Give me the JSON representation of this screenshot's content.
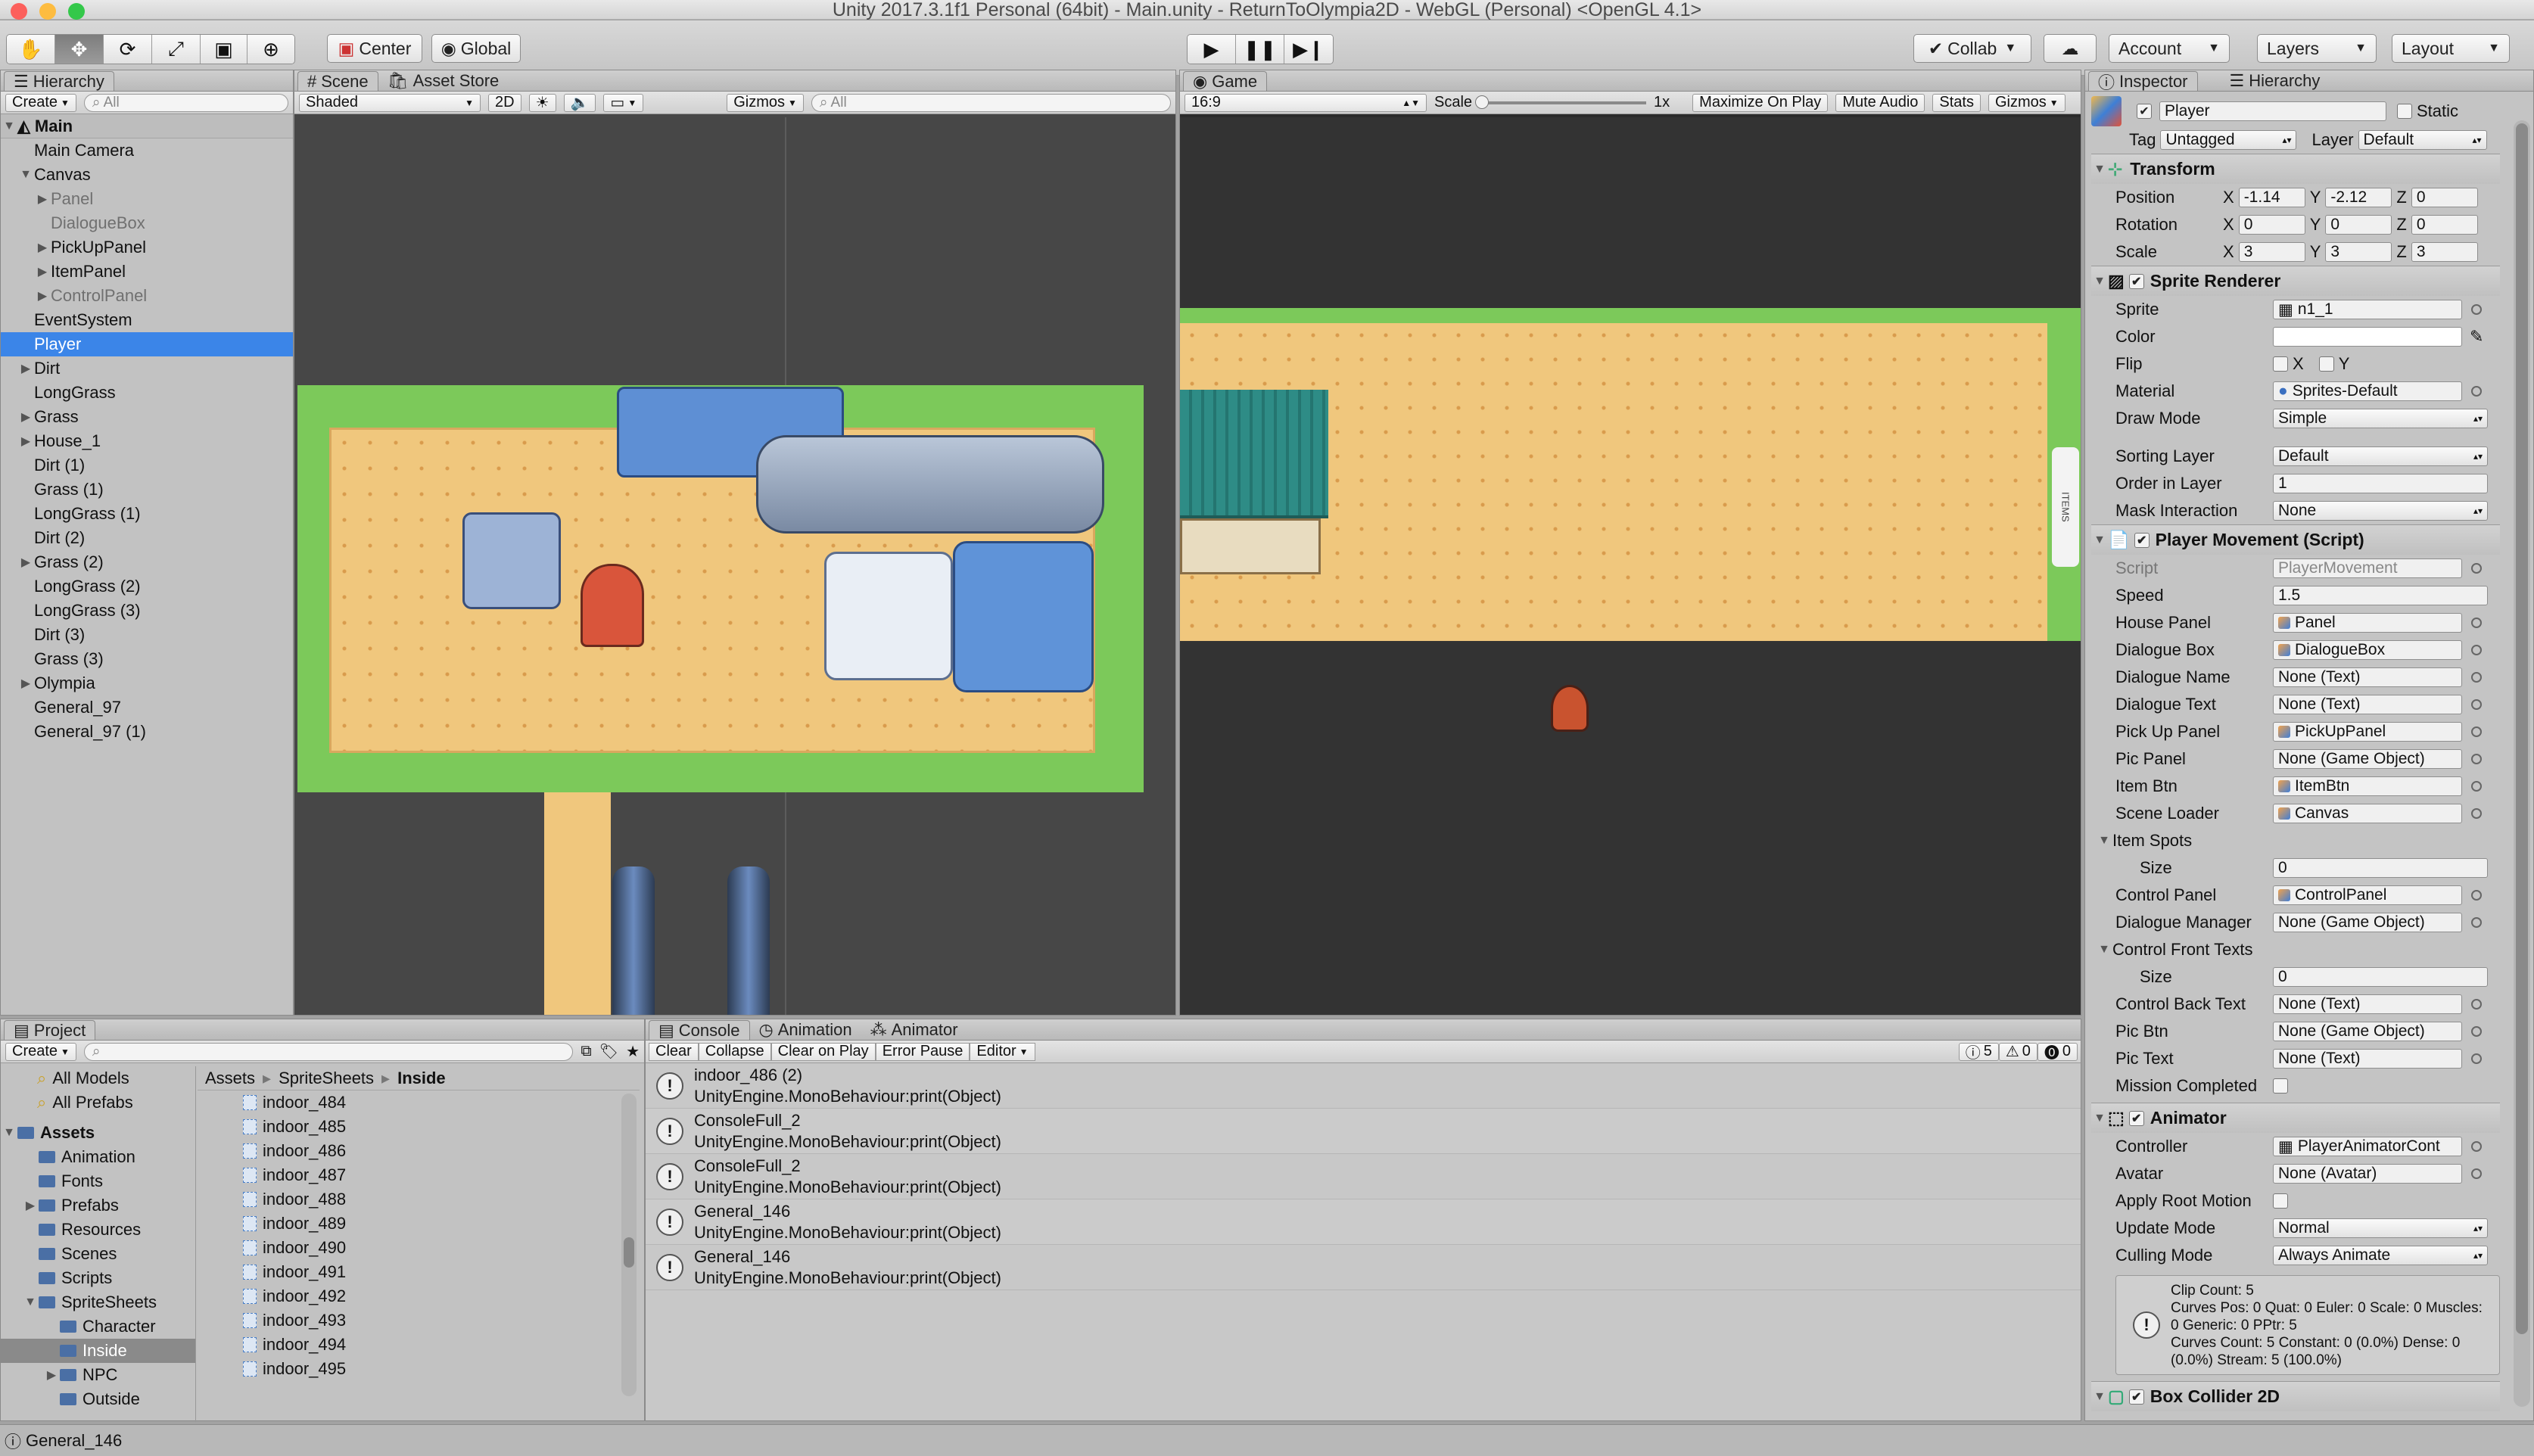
{
  "window": {
    "title": "Unity 2017.3.1f1 Personal (64bit) - Main.unity - ReturnToOlympia2D - WebGL (Personal) <OpenGL 4.1>"
  },
  "toolbar": {
    "tools": [
      "hand-icon",
      "move-icon",
      "rotate-icon",
      "scale-icon",
      "rect-icon",
      "transform-icon"
    ],
    "pivot": "Center",
    "space": "Global",
    "collab": "Collab",
    "account": "Account",
    "layers": "Layers",
    "layout": "Layout"
  },
  "hierarchy": {
    "tab": "Hierarchy",
    "create": "Create",
    "search": "All",
    "scene": "Main",
    "items": [
      {
        "label": "Main Camera",
        "depth": 1,
        "arrow": "",
        "dim": false
      },
      {
        "label": "Canvas",
        "depth": 1,
        "arrow": "▼",
        "dim": false
      },
      {
        "label": "Panel",
        "depth": 2,
        "arrow": "▶",
        "dim": true
      },
      {
        "label": "DialogueBox",
        "depth": 2,
        "arrow": "",
        "dim": true
      },
      {
        "label": "PickUpPanel",
        "depth": 2,
        "arrow": "▶",
        "dim": false
      },
      {
        "label": "ItemPanel",
        "depth": 2,
        "arrow": "▶",
        "dim": false
      },
      {
        "label": "ControlPanel",
        "depth": 2,
        "arrow": "▶",
        "dim": true
      },
      {
        "label": "EventSystem",
        "depth": 1,
        "arrow": "",
        "dim": false
      },
      {
        "label": "Player",
        "depth": 1,
        "arrow": "",
        "dim": false,
        "selected": true
      },
      {
        "label": "Dirt",
        "depth": 1,
        "arrow": "▶",
        "dim": false
      },
      {
        "label": "LongGrass",
        "depth": 1,
        "arrow": "",
        "dim": false
      },
      {
        "label": "Grass",
        "depth": 1,
        "arrow": "▶",
        "dim": false
      },
      {
        "label": "House_1",
        "depth": 1,
        "arrow": "▶",
        "dim": false
      },
      {
        "label": "Dirt (1)",
        "depth": 1,
        "arrow": "",
        "dim": false
      },
      {
        "label": "Grass (1)",
        "depth": 1,
        "arrow": "",
        "dim": false
      },
      {
        "label": "LongGrass (1)",
        "depth": 1,
        "arrow": "",
        "dim": false
      },
      {
        "label": "Dirt (2)",
        "depth": 1,
        "arrow": "",
        "dim": false
      },
      {
        "label": "Grass (2)",
        "depth": 1,
        "arrow": "▶",
        "dim": false
      },
      {
        "label": "LongGrass (2)",
        "depth": 1,
        "arrow": "",
        "dim": false
      },
      {
        "label": "LongGrass (3)",
        "depth": 1,
        "arrow": "",
        "dim": false
      },
      {
        "label": "Dirt (3)",
        "depth": 1,
        "arrow": "",
        "dim": false
      },
      {
        "label": "Grass (3)",
        "depth": 1,
        "arrow": "",
        "dim": false
      },
      {
        "label": "Olympia",
        "depth": 1,
        "arrow": "▶",
        "dim": false
      },
      {
        "label": "General_97",
        "depth": 1,
        "arrow": "",
        "dim": false
      },
      {
        "label": "General_97 (1)",
        "depth": 1,
        "arrow": "",
        "dim": false
      }
    ]
  },
  "scene": {
    "tab": "Scene",
    "tab2": "Asset Store",
    "shading": "Shaded",
    "mode2d": "2D",
    "gizmos": "Gizmos",
    "search": "All"
  },
  "game": {
    "tab": "Game",
    "aspect": "16:9",
    "scale_label": "Scale",
    "scale_value": "1x",
    "maximize": "Maximize On Play",
    "mute": "Mute Audio",
    "stats": "Stats",
    "gizmos": "Gizmos",
    "side_tab": "ITEMS"
  },
  "inspector": {
    "tab": "Inspector",
    "tab2": "Hierarchy",
    "name": "Player",
    "static": "Static",
    "tag_label": "Tag",
    "tag": "Untagged",
    "layer_label": "Layer",
    "layer": "Default",
    "transform": {
      "title": "Transform",
      "rows": [
        {
          "label": "Position",
          "x": "-1.14",
          "y": "-2.12",
          "z": "0"
        },
        {
          "label": "Rotation",
          "x": "0",
          "y": "0",
          "z": "0"
        },
        {
          "label": "Scale",
          "x": "3",
          "y": "3",
          "z": "3"
        }
      ]
    },
    "sprite_renderer": {
      "title": "Sprite Renderer",
      "sprite_label": "Sprite",
      "sprite": "n1_1",
      "color_label": "Color",
      "flip_label": "Flip",
      "flip_x": "X",
      "flip_y": "Y",
      "material_label": "Material",
      "material": "Sprites-Default",
      "draw_mode_label": "Draw Mode",
      "draw_mode": "Simple",
      "sorting_layer_label": "Sorting Layer",
      "sorting_layer": "Default",
      "order_label": "Order in Layer",
      "order": "1",
      "mask_label": "Mask Interaction",
      "mask": "None"
    },
    "player_movement": {
      "title": "Player Movement (Script)",
      "fields": [
        {
          "label": "Script",
          "value": "PlayerMovement",
          "kind": "ref",
          "dim": true
        },
        {
          "label": "Speed",
          "value": "1.5",
          "kind": "text"
        },
        {
          "label": "House Panel",
          "value": "Panel",
          "kind": "ref",
          "icon": true
        },
        {
          "label": "Dialogue Box",
          "value": "DialogueBox",
          "kind": "ref",
          "icon": true
        },
        {
          "label": "Dialogue Name",
          "value": "None (Text)",
          "kind": "ref"
        },
        {
          "label": "Dialogue Text",
          "value": "None (Text)",
          "kind": "ref"
        },
        {
          "label": "Pick Up Panel",
          "value": "PickUpPanel",
          "kind": "ref",
          "icon": true
        },
        {
          "label": "Pic Panel",
          "value": "None (Game Object)",
          "kind": "ref"
        },
        {
          "label": "Item Btn",
          "value": "ItemBtn",
          "kind": "ref",
          "icon": true
        },
        {
          "label": "Scene Loader",
          "value": "Canvas",
          "kind": "ref",
          "icon": true
        },
        {
          "label": "Item Spots",
          "value": "",
          "kind": "foldout"
        },
        {
          "label": "Size",
          "value": "0",
          "kind": "text",
          "indent": true
        },
        {
          "label": "Control Panel",
          "value": "ControlPanel",
          "kind": "ref",
          "icon": true
        },
        {
          "label": "Dialogue Manager",
          "value": "None (Game Object)",
          "kind": "ref"
        },
        {
          "label": "Control Front Texts",
          "value": "",
          "kind": "foldout"
        },
        {
          "label": "Size",
          "value": "0",
          "kind": "text",
          "indent": true
        },
        {
          "label": "Control Back Text",
          "value": "None (Text)",
          "kind": "ref"
        },
        {
          "label": "Pic Btn",
          "value": "None (Game Object)",
          "kind": "ref"
        },
        {
          "label": "Pic Text",
          "value": "None (Text)",
          "kind": "ref"
        },
        {
          "label": "Mission Completed",
          "value": "",
          "kind": "check"
        }
      ]
    },
    "animator": {
      "title": "Animator",
      "controller_label": "Controller",
      "controller": "PlayerAnimatorCont",
      "avatar_label": "Avatar",
      "avatar": "None (Avatar)",
      "root_motion_label": "Apply Root Motion",
      "update_label": "Update Mode",
      "update": "Normal",
      "culling_label": "Culling Mode",
      "culling": "Always Animate",
      "info": [
        "Clip Count: 5",
        "Curves Pos: 0 Quat: 0 Euler: 0 Scale: 0 Muscles:",
        "0 Generic: 0 PPtr: 5",
        "Curves Count: 5 Constant: 0 (0.0%) Dense: 0",
        "(0.0%) Stream: 5 (100.0%)"
      ]
    },
    "box_collider": {
      "title": "Box Collider 2D"
    }
  },
  "project": {
    "tab": "Project",
    "create": "Create",
    "favorites": [
      "All Models",
      "All Prefabs"
    ],
    "tree": [
      {
        "label": "Assets",
        "depth": 0,
        "arrow": "▼",
        "bold": true
      },
      {
        "label": "Animation",
        "depth": 1,
        "arrow": ""
      },
      {
        "label": "Fonts",
        "depth": 1,
        "arrow": ""
      },
      {
        "label": "Prefabs",
        "depth": 1,
        "arrow": "▶"
      },
      {
        "label": "Resources",
        "depth": 1,
        "arrow": ""
      },
      {
        "label": "Scenes",
        "depth": 1,
        "arrow": ""
      },
      {
        "label": "Scripts",
        "depth": 1,
        "arrow": ""
      },
      {
        "label": "SpriteSheets",
        "depth": 1,
        "arrow": "▼"
      },
      {
        "label": "Character",
        "depth": 2,
        "arrow": ""
      },
      {
        "label": "Inside",
        "depth": 2,
        "arrow": "",
        "selected": true
      },
      {
        "label": "NPC",
        "depth": 2,
        "arrow": "▶"
      },
      {
        "label": "Outside",
        "depth": 2,
        "arrow": ""
      }
    ],
    "breadcrumb": [
      "Assets",
      "SpriteSheets",
      "Inside"
    ],
    "files": [
      "indoor_484",
      "indoor_485",
      "indoor_486",
      "indoor_487",
      "indoor_488",
      "indoor_489",
      "indoor_490",
      "indoor_491",
      "indoor_492",
      "indoor_493",
      "indoor_494",
      "indoor_495"
    ]
  },
  "console": {
    "tab": "Console",
    "tab2": "Animation",
    "tab3": "Animator",
    "buttons": [
      "Clear",
      "Collapse",
      "Clear on Play",
      "Error Pause",
      "Editor"
    ],
    "counts": {
      "info": "5",
      "warn": "0",
      "error": "0"
    },
    "entries": [
      {
        "line1": "indoor_486 (2)",
        "line2": "UnityEngine.MonoBehaviour:print(Object)"
      },
      {
        "line1": "ConsoleFull_2",
        "line2": "UnityEngine.MonoBehaviour:print(Object)"
      },
      {
        "line1": "ConsoleFull_2",
        "line2": "UnityEngine.MonoBehaviour:print(Object)"
      },
      {
        "line1": "General_146",
        "line2": "UnityEngine.MonoBehaviour:print(Object)"
      },
      {
        "line1": "General_146",
        "line2": "UnityEngine.MonoBehaviour:print(Object)"
      }
    ]
  },
  "status": {
    "text": "General_146"
  },
  "colors": {
    "selection": "#3b85e8",
    "grass": "#7cc95a",
    "sand": "#f0c77d",
    "dark": "#474747"
  }
}
